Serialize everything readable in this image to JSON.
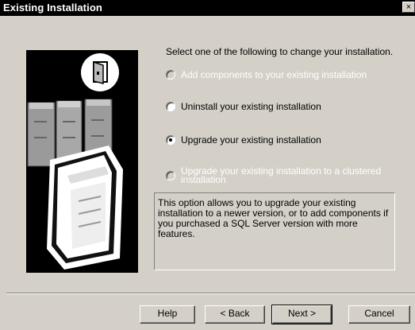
{
  "window": {
    "title": "Existing Installation",
    "close_glyph": "×"
  },
  "prompt": "Select one of the following to change your installation.",
  "options": [
    {
      "label": "Add components to your existing installation",
      "selected": false,
      "enabled": false
    },
    {
      "label": "Uninstall your existing installation",
      "selected": false,
      "enabled": true
    },
    {
      "label": "Upgrade your existing installation",
      "selected": true,
      "enabled": true
    },
    {
      "label_line1": "Upgrade your existing installation to a clustered",
      "label_line2": "installation",
      "selected": false,
      "enabled": false
    }
  ],
  "description": {
    "line1": "This option allows you to upgrade your existing",
    "line2": "installation to a newer version, or to add components if",
    "line3": "you purchased a SQL Server version with more features."
  },
  "buttons": {
    "help": "Help",
    "back": "< Back",
    "next": "Next >",
    "cancel": "Cancel"
  },
  "icons": {
    "illustration": "server-stack-illustration",
    "document": "document-icon"
  }
}
